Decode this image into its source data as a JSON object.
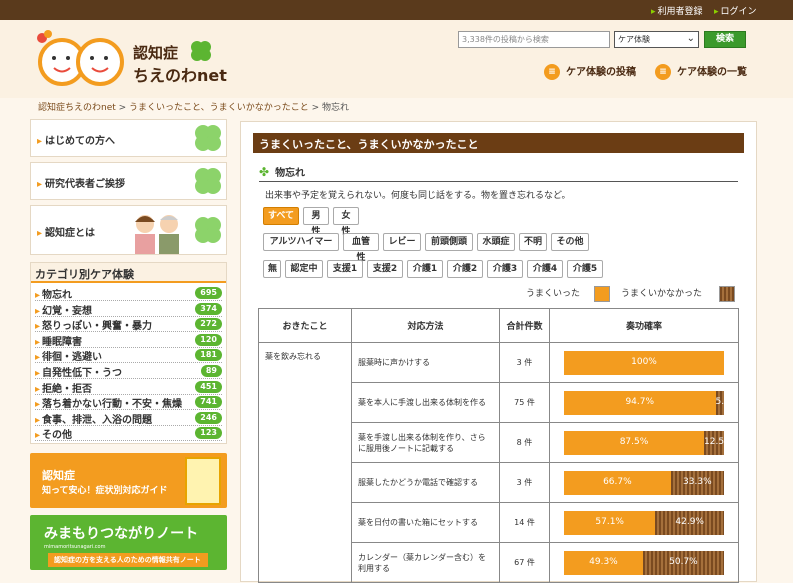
{
  "topnav": {
    "register": "利用者登録",
    "login": "ログイン"
  },
  "logo": {
    "line1": "認知症",
    "line2": "ちえのわnet",
    "ruby": "ねっと"
  },
  "search": {
    "placeholder": "3,338件の投稿から検索",
    "select_value": "ケア体験",
    "button": "検索"
  },
  "nav": {
    "post": "ケア体験の投稿",
    "list": "ケア体験の一覧"
  },
  "breadcrumb": {
    "home": "認知症ちえのわnet",
    "sep": " > ",
    "parent": "うまくいったこと、うまくいかなかったこと",
    "current": "物忘れ"
  },
  "sidebar": {
    "buttons": [
      "はじめての方へ",
      "研究代表者ご挨拶",
      "認知症とは"
    ],
    "category_title": "カテゴリ別ケア体験",
    "categories": [
      {
        "label": "物忘れ",
        "count": "695"
      },
      {
        "label": "幻覚・妄想",
        "count": "374"
      },
      {
        "label": "怒りっぽい・興奮・暴力",
        "count": "272"
      },
      {
        "label": "睡眠障害",
        "count": "120"
      },
      {
        "label": "徘徊・逃避い",
        "count": "181"
      },
      {
        "label": "自発性低下・うつ",
        "count": "89"
      },
      {
        "label": "拒絶・拒否",
        "count": "451"
      },
      {
        "label": "落ち着かない行動・不安・焦燥",
        "count": "741"
      },
      {
        "label": "食事、排泄、入浴の問題",
        "count": "246"
      },
      {
        "label": "その他",
        "count": "123"
      }
    ],
    "banner1": {
      "line1": "認知症",
      "line2": "知って安心！症状別対応ガイド"
    },
    "banner2": {
      "line1": "みまもりつながりノート",
      "url": "mimamoritsunagari.com",
      "line2": "認知症の方を支える人のための情報共有ノート"
    }
  },
  "main": {
    "section_title": "うまくいったこと、うまくいかなかったこと",
    "sub_title": "物忘れ",
    "description": "出来事や予定を覚えられない。何度も同じ話をする。物を置き忘れるなど。",
    "filters_gender": [
      "すべて",
      "男性",
      "女性"
    ],
    "filters_type": [
      "アルツハイマー",
      "血管性",
      "レビー",
      "前頭側頭",
      "水頭症",
      "不明",
      "その他"
    ],
    "filters_level": [
      "無",
      "認定中",
      "支援1",
      "支援2",
      "介護1",
      "介護2",
      "介護3",
      "介護4",
      "介護5"
    ],
    "legend": {
      "ok": "うまくいった",
      "ng": "うまくいかなかった"
    },
    "table": {
      "headers": [
        "おきたこと",
        "対応方法",
        "合計件数",
        "奏功確率"
      ],
      "cause": "薬を飲み忘れる",
      "rows": [
        {
          "method": "服薬時に声かけする",
          "count": "3 件",
          "ok": 100,
          "ok_label": "100%",
          "ng_label": ""
        },
        {
          "method": "薬を本人に手渡し出来る体制を作る",
          "count": "75 件",
          "ok": 94.7,
          "ok_label": "94.7%",
          "ng_label": "5.3%"
        },
        {
          "method": "薬を手渡し出来る体制を作り、さらに服用後ノートに記載する",
          "count": "8 件",
          "ok": 87.5,
          "ok_label": "87.5%",
          "ng_label": "12.5%"
        },
        {
          "method": "服薬したかどうか電話で確認する",
          "count": "3 件",
          "ok": 66.7,
          "ok_label": "66.7%",
          "ng_label": "33.3%"
        },
        {
          "method": "薬を日付の書いた箱にセットする",
          "count": "14 件",
          "ok": 57.1,
          "ok_label": "57.1%",
          "ng_label": "42.9%"
        },
        {
          "method": "カレンダー（薬カレンダー含む）を利用する",
          "count": "67 件",
          "ok": 49.3,
          "ok_label": "49.3%",
          "ng_label": "50.7%"
        }
      ]
    }
  },
  "colors": {
    "accent": "#f39c1f",
    "brown": "#6b3d14",
    "green": "#5cb531"
  }
}
